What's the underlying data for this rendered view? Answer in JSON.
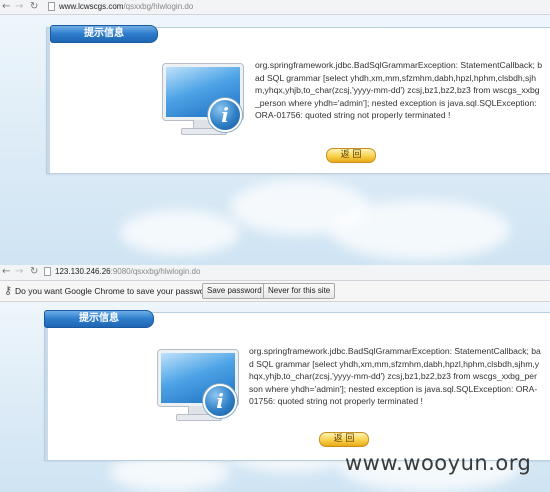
{
  "shots": [
    {
      "browser": {
        "url_host": "www.lcwscgs.com",
        "url_path": "/qsxxbg/hlwlogin.do"
      },
      "tab_title": "提示信息",
      "message": "org.springframework.jdbc.BadSqlGrammarException: StatementCallback; bad SQL grammar [select yhdh,xm,mm,sfzmhm,dabh,hpzl,hphm,clsbdh,sjhm,yhqx,yhjb,to_char(zcsj,'yyyy-mm-dd') zcsj,bz1,bz2,bz3 from wscgs_xxbg_person where yhdh='admin']; nested exception is java.sql.SQLException: ORA-01756: quoted string not properly terminated !",
      "back_label": "返 回"
    },
    {
      "browser": {
        "url_host": "123.130.246.26",
        "url_path": ":9080/qsxxbg/hlwlogin.do"
      },
      "infobar": {
        "prompt": "Do you want Google Chrome to save your password?",
        "save_label": "Save password",
        "never_label": "Never for this site"
      },
      "tab_title": "提示信息",
      "message": "org.springframework.jdbc.BadSqlGrammarException: StatementCallback; bad SQL grammar [select yhdh,xm,mm,sfzmhm,dabh,hpzl,hphm,clsbdh,sjhm,yhqx,yhjb,to_char(zcsj,'yyyy-mm-dd') zcsj,bz1,bz2,bz3 from wscgs_xxbg_person where yhdh='admin']; nested exception is java.sql.SQLException: ORA-01756: quoted string not properly terminated !",
      "back_label": "返 回"
    }
  ],
  "watermark": "www.wooyun.org",
  "icons": {
    "back": "arrow-left-icon",
    "forward": "arrow-right-icon",
    "reload": "reload-icon",
    "page": "page-icon",
    "key": "key-icon",
    "monitor": "monitor-info-icon"
  },
  "colors": {
    "tab_blue": "#2d7ccb",
    "button_gold": "#f8d14a",
    "sky": "#dcebf6"
  }
}
